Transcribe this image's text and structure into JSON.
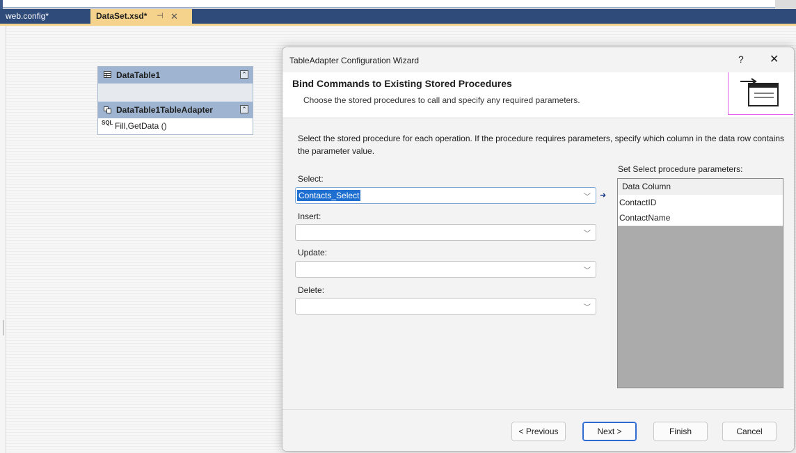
{
  "tabs": [
    {
      "label": "web.config*"
    },
    {
      "label": "DataSet.xsd*"
    }
  ],
  "tab_icons": [
    "pin-icon",
    "close-icon"
  ],
  "designer": {
    "datatable": {
      "title": "DataTable1"
    },
    "adapter": {
      "title": "DataTable1TableAdapter",
      "query": "Fill,GetData ()",
      "sql_icon": "SQL"
    }
  },
  "dialog": {
    "title": "TableAdapter Configuration Wizard",
    "help": "?",
    "close": "✕",
    "header_title": "Bind Commands to Existing Stored Procedures",
    "header_subtitle": "Choose the stored procedures to call and specify any required parameters.",
    "instructions": "Select the stored procedure for each operation. If the procedure requires parameters, specify which column in the data row contains the parameter value.",
    "select_label": "Select:",
    "select_value": "Contacts_Select",
    "insert_label": "Insert:",
    "insert_value": "",
    "update_label": "Update:",
    "update_value": "",
    "delete_label": "Delete:",
    "delete_value": "",
    "params_label": "Set Select procedure parameters:",
    "params_header": "Data Column",
    "params_rows": [
      "ContactID",
      "ContactName"
    ],
    "buttons": {
      "previous": "< Previous",
      "next": "Next >",
      "finish": "Finish",
      "cancel": "Cancel"
    }
  },
  "colors": {
    "tab_bar": "#2e4b7a",
    "active_tab": "#f6d38c",
    "shape_header": "#9fb4d0",
    "selection": "#1e6fd0"
  }
}
